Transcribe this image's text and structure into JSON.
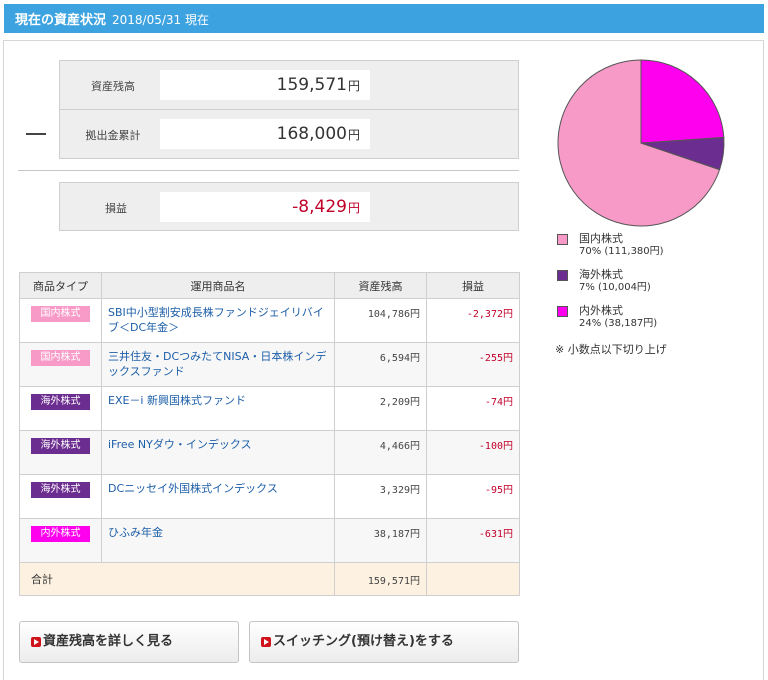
{
  "header": {
    "title": "現在の資産状況",
    "date": "2018/05/31 現在"
  },
  "summary": {
    "asset_balance_label": "資産残高",
    "asset_balance_value": "159,571",
    "contribution_label": "拠出金累計",
    "contribution_value": "168,000",
    "pl_label": "損益",
    "pl_value": "-8,429",
    "unit": "円"
  },
  "table": {
    "headers": [
      "商品タイプ",
      "運用商品名",
      "資産残高",
      "損益"
    ],
    "rows": [
      {
        "type": "国内株式",
        "name": "SBI中小型割安成長株ファンドジェイリバイブ＜DC年金＞",
        "balance": "104,786円",
        "pl": "-2,372円"
      },
      {
        "type": "国内株式",
        "name": "三井住友・DCつみたてNISA・日本株インデックスファンド",
        "balance": "6,594円",
        "pl": "-255円"
      },
      {
        "type": "海外株式",
        "name": "EXE－i 新興国株式ファンド",
        "balance": "2,209円",
        "pl": "-74円"
      },
      {
        "type": "海外株式",
        "name": "iFree NYダウ・インデックス",
        "balance": "4,466円",
        "pl": "-100円"
      },
      {
        "type": "海外株式",
        "name": "DCニッセイ外国株式インデックス",
        "balance": "3,329円",
        "pl": "-95円"
      },
      {
        "type": "内外株式",
        "name": "ひふみ年金",
        "balance": "38,187円",
        "pl": "-631円"
      }
    ],
    "total_label": "合計",
    "total_balance": "159,571円",
    "total_pl": ""
  },
  "buttons": {
    "detail_label": "資産残高を詳しく見る",
    "switching_label": "スイッチング(預け替え)をする"
  },
  "legend": [
    {
      "name": "国内株式",
      "detail": "70% (111,380円)",
      "color": "#f79ac8"
    },
    {
      "name": "海外株式",
      "detail": "7% (10,004円)",
      "color": "#6b2d8f"
    },
    {
      "name": "内外株式",
      "detail": "24% (38,187円)",
      "color": "#ff00ee"
    }
  ],
  "note": "※ 小数点以下切り上げ",
  "chart_data": {
    "type": "pie",
    "categories": [
      "国内株式",
      "海外株式",
      "内外株式"
    ],
    "values": [
      111380,
      10004,
      38187
    ],
    "percent": [
      70,
      7,
      24
    ],
    "colors": [
      "#f79ac8",
      "#6b2d8f",
      "#ff00ee"
    ]
  },
  "colors": {
    "header_bg": "#3da3e0",
    "negative": "#c0002a",
    "link": "#1c5ea8"
  }
}
